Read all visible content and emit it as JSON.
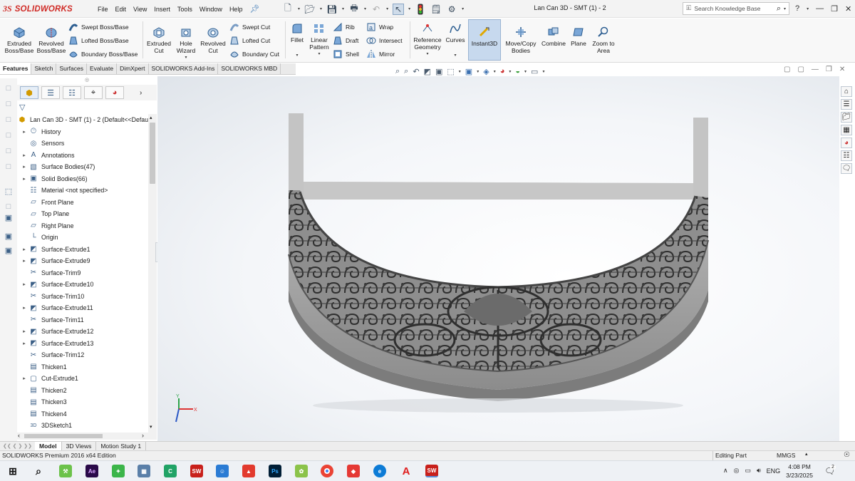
{
  "app": {
    "brand": "SOLIDWORKS",
    "brand_mark": "3S",
    "accent": "#d02b26"
  },
  "menu": [
    "File",
    "Edit",
    "View",
    "Insert",
    "Tools",
    "Window",
    "Help"
  ],
  "document_title": "Lan Can 3D - SMT (1) - 2",
  "search": {
    "placeholder": "Search Knowledge Base"
  },
  "ribbon": {
    "extruded_boss": "Extruded Boss/Base",
    "revolved_boss": "Revolved Boss/Base",
    "swept_boss": "Swept Boss/Base",
    "lofted_boss": "Lofted Boss/Base",
    "boundary_boss": "Boundary Boss/Base",
    "extruded_cut": "Extruded Cut",
    "hole_wizard": "Hole Wizard",
    "revolved_cut": "Revolved Cut",
    "swept_cut": "Swept Cut",
    "lofted_cut": "Lofted Cut",
    "boundary_cut": "Boundary Cut",
    "fillet": "Fillet",
    "linear_pattern": "Linear Pattern",
    "rib": "Rib",
    "draft": "Draft",
    "shell": "Shell",
    "wrap": "Wrap",
    "intersect": "Intersect",
    "mirror": "Mirror",
    "reference_geometry": "Reference Geometry",
    "curves": "Curves",
    "instant3d": "Instant3D",
    "move_copy": "Move/Copy Bodies",
    "combine": "Combine",
    "plane": "Plane",
    "zoom_area": "Zoom to Area"
  },
  "command_tabs": [
    "Features",
    "Sketch",
    "Surfaces",
    "Evaluate",
    "DimXpert",
    "SOLIDWORKS Add-Ins",
    "SOLIDWORKS MBD"
  ],
  "tree": {
    "root": "Lan Can 3D - SMT (1) - 2  (Default<<Defau",
    "items": [
      {
        "label": "History",
        "expand": true,
        "icon": "history-icon"
      },
      {
        "label": "Sensors",
        "expand": false,
        "icon": "sensors-icon"
      },
      {
        "label": "Annotations",
        "expand": true,
        "icon": "annotations-icon"
      },
      {
        "label": "Surface Bodies(47)",
        "expand": true,
        "icon": "surface-bodies-icon"
      },
      {
        "label": "Solid Bodies(66)",
        "expand": true,
        "icon": "solid-bodies-icon"
      },
      {
        "label": "Material <not specified>",
        "expand": false,
        "icon": "material-icon"
      },
      {
        "label": "Front Plane",
        "expand": false,
        "icon": "plane-icon"
      },
      {
        "label": "Top Plane",
        "expand": false,
        "icon": "plane-icon"
      },
      {
        "label": "Right Plane",
        "expand": false,
        "icon": "plane-icon"
      },
      {
        "label": "Origin",
        "expand": false,
        "icon": "origin-icon"
      },
      {
        "label": "Surface-Extrude1",
        "expand": true,
        "icon": "surface-extrude-icon"
      },
      {
        "label": "Surface-Extrude9",
        "expand": true,
        "icon": "surface-extrude-icon"
      },
      {
        "label": "Surface-Trim9",
        "expand": false,
        "icon": "surface-trim-icon"
      },
      {
        "label": "Surface-Extrude10",
        "expand": true,
        "icon": "surface-extrude-icon"
      },
      {
        "label": "Surface-Trim10",
        "expand": false,
        "icon": "surface-trim-icon"
      },
      {
        "label": "Surface-Extrude11",
        "expand": true,
        "icon": "surface-extrude-icon"
      },
      {
        "label": "Surface-Trim11",
        "expand": false,
        "icon": "surface-trim-icon"
      },
      {
        "label": "Surface-Extrude12",
        "expand": true,
        "icon": "surface-extrude-icon"
      },
      {
        "label": "Surface-Extrude13",
        "expand": true,
        "icon": "surface-extrude-icon"
      },
      {
        "label": "Surface-Trim12",
        "expand": false,
        "icon": "surface-trim-icon"
      },
      {
        "label": "Thicken1",
        "expand": false,
        "icon": "thicken-icon"
      },
      {
        "label": "Cut-Extrude1",
        "expand": true,
        "icon": "cut-extrude-icon"
      },
      {
        "label": "Thicken2",
        "expand": false,
        "icon": "thicken-icon"
      },
      {
        "label": "Thicken3",
        "expand": false,
        "icon": "thicken-icon"
      },
      {
        "label": "Thicken4",
        "expand": false,
        "icon": "thicken-icon"
      },
      {
        "label": "3DSketch1",
        "expand": false,
        "icon": "3dsketch-icon",
        "badge": "3D"
      }
    ]
  },
  "bottom_tabs": [
    "Model",
    "3D Views",
    "Motion Study 1"
  ],
  "status": {
    "edition": "SOLIDWORKS Premium 2016 x64 Edition",
    "mode": "Editing Part",
    "units": "MMGS"
  },
  "triad": {
    "x": "X",
    "y": "Y"
  },
  "clock": {
    "time": "4:08 PM",
    "date": "3/23/2025"
  },
  "tray": {
    "lang": "ENG",
    "notify_count": "2"
  }
}
